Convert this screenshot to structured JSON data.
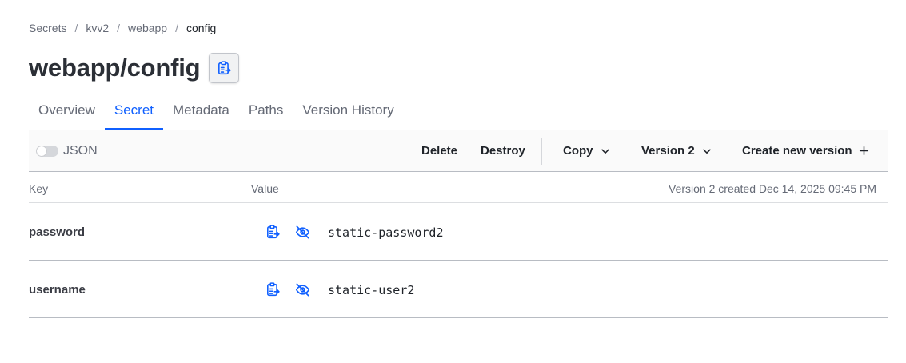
{
  "breadcrumb": [
    "Secrets",
    "kvv2",
    "webapp",
    "config"
  ],
  "page_title": "webapp/config",
  "tabs": [
    "Overview",
    "Secret",
    "Metadata",
    "Paths",
    "Version History"
  ],
  "active_tab": "Secret",
  "toolbar": {
    "json_toggle_label": "JSON",
    "json_toggle_on": false,
    "delete_label": "Delete",
    "destroy_label": "Destroy",
    "copy_label": "Copy",
    "version_label": "Version 2",
    "create_label": "Create new version"
  },
  "table": {
    "key_header": "Key",
    "value_header": "Value",
    "version_meta": "Version 2 created Dec 14, 2025 09:45 PM",
    "rows": [
      {
        "key": "password",
        "value": "static-password2"
      },
      {
        "key": "username",
        "value": "static-user2"
      }
    ]
  },
  "colors": {
    "accent": "#1060ff",
    "text": "#1f2329",
    "muted": "#656a76"
  },
  "icons": [
    "clipboard-copy-icon",
    "chevron-down-icon",
    "plus-icon",
    "eye-off-icon"
  ]
}
